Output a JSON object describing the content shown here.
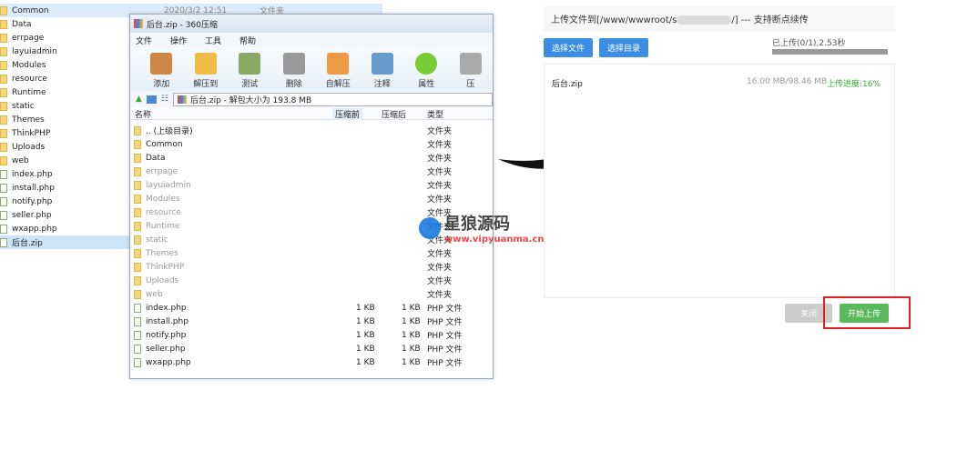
{
  "explorer": {
    "items": [
      "Common",
      "Data",
      "errpage",
      "layuiadmin",
      "Modules",
      "resource",
      "Runtime",
      "static",
      "Themes",
      "ThinkPHP",
      "Uploads",
      "web",
      "index.php",
      "install.php",
      "notify.php",
      "seller.php",
      "wxapp.php",
      "后台.zip"
    ],
    "first_date": "2020/3/2 12:51",
    "first_type": "文件夹"
  },
  "zip": {
    "title": "后台.zip - 360压缩",
    "menu": [
      "文件",
      "操作",
      "工具",
      "帮助"
    ],
    "toolbar": [
      "添加",
      "解压到",
      "测试",
      "删除",
      "自解压",
      "注释",
      "属性",
      "压"
    ],
    "address": "后台.zip - 解包大小为 193.8 MB",
    "columns": [
      "名称",
      "压缩前",
      "压缩后",
      "类型"
    ],
    "rows": [
      {
        "name": ".. (上级目录)",
        "before": "",
        "after": "",
        "type": "文件夹"
      },
      {
        "name": "Common",
        "before": "",
        "after": "",
        "type": "文件夹"
      },
      {
        "name": "Data",
        "before": "",
        "after": "",
        "type": "文件夹"
      },
      {
        "name": "errpage",
        "before": "",
        "after": "",
        "type": "文件夹"
      },
      {
        "name": "layuiadmin",
        "before": "",
        "after": "",
        "type": "文件夹"
      },
      {
        "name": "Modules",
        "before": "",
        "after": "",
        "type": "文件夹"
      },
      {
        "name": "resource",
        "before": "",
        "after": "",
        "type": "文件夹"
      },
      {
        "name": "Runtime",
        "before": "",
        "after": "",
        "type": "文件夹"
      },
      {
        "name": "static",
        "before": "",
        "after": "",
        "type": "文件夹"
      },
      {
        "name": "Themes",
        "before": "",
        "after": "",
        "type": "文件夹"
      },
      {
        "name": "ThinkPHP",
        "before": "",
        "after": "",
        "type": "文件夹"
      },
      {
        "name": "Uploads",
        "before": "",
        "after": "",
        "type": "文件夹"
      },
      {
        "name": "web",
        "before": "",
        "after": "",
        "type": "文件夹"
      },
      {
        "name": "index.php",
        "before": "1 KB",
        "after": "1 KB",
        "type": "PHP 文件"
      },
      {
        "name": "install.php",
        "before": "1 KB",
        "after": "1 KB",
        "type": "PHP 文件"
      },
      {
        "name": "notify.php",
        "before": "1 KB",
        "after": "1 KB",
        "type": "PHP 文件"
      },
      {
        "name": "seller.php",
        "before": "1 KB",
        "after": "1 KB",
        "type": "PHP 文件"
      },
      {
        "name": "wxapp.php",
        "before": "1 KB",
        "after": "1 KB",
        "type": "PHP 文件"
      }
    ]
  },
  "upload": {
    "header_prefix": "上传文件到[/www/wwwroot/s",
    "header_suffix": "/] --- 支持断点续传",
    "select_file": "选择文件",
    "select_dir": "选择目录",
    "status": "已上传(0/1),2.53秒",
    "file": {
      "name": "后台.zip",
      "size": "16.00 MB/98.46 MB",
      "progress": "上传进度:16%",
      "percent": 16
    },
    "close": "关闭",
    "start": "开始上传",
    "accent": "#3c8de4",
    "green": "#5cb85c",
    "highlight": "#e02020"
  },
  "watermark": {
    "title": "星狼源码",
    "url": "www.vipyuanma.cn"
  }
}
